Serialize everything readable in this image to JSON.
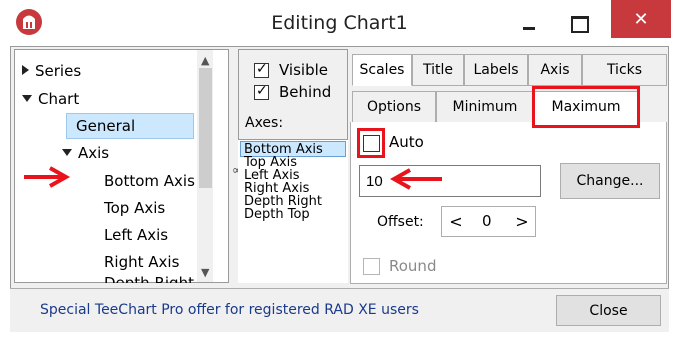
{
  "window": {
    "title": "Editing Chart1",
    "close_glyph": "✕"
  },
  "tree": {
    "items": [
      {
        "label": "Series",
        "state": "collapsed"
      },
      {
        "label": "Chart",
        "state": "expanded"
      },
      {
        "label": "General"
      },
      {
        "label": "Axis",
        "state": "expanded"
      },
      {
        "label": "Bottom Axis",
        "selected": true
      },
      {
        "label": "Top Axis"
      },
      {
        "label": "Left Axis"
      },
      {
        "label": "Right Axis"
      },
      {
        "label": "Depth Right"
      }
    ]
  },
  "axes_panel": {
    "visible_label": "Visible",
    "visible_checked": true,
    "behind_label": "Behind",
    "behind_checked": true,
    "axes_heading": "Axes:",
    "axes": [
      "Bottom Axis",
      "Top Axis",
      "Left Axis",
      "Right Axis",
      "Depth Right",
      "Depth Top"
    ],
    "selected_axis": "Bottom Axis"
  },
  "tabs_row1": [
    "Scales",
    "Title",
    "Labels",
    "Axis",
    "Ticks"
  ],
  "tabs_row2": [
    "Options",
    "Minimum",
    "Maximum"
  ],
  "active_tab_row1": "Scales",
  "active_tab_row2": "Maximum",
  "maximum": {
    "auto_label": "Auto",
    "auto_checked": false,
    "value": "10",
    "change_label": "Change...",
    "offset_label": "Offset:",
    "offset_value": "0",
    "offset_dec": "<",
    "offset_inc": ">",
    "round_label": "Round",
    "round_checked": false
  },
  "footer": {
    "link_text": "Special TeeChart Pro offer for registered RAD XE users",
    "close_label": "Close"
  },
  "colors": {
    "highlight_red": "#e8131b",
    "titlebar_close": "#c7393c",
    "selection": "#cce8ff",
    "link": "#1a3a8a"
  }
}
